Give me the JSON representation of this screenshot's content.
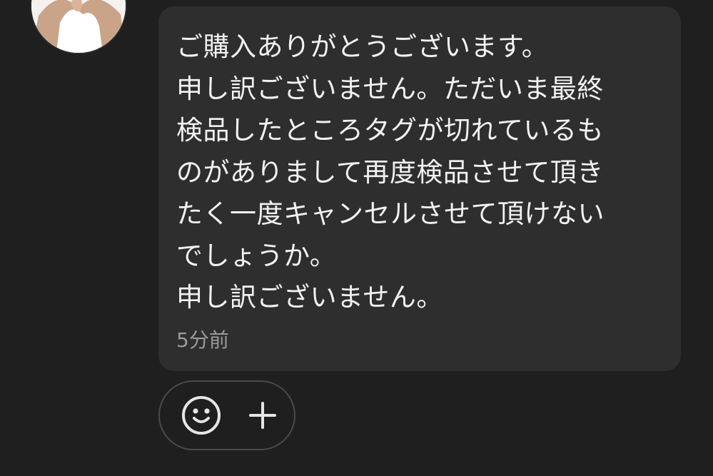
{
  "chat": {
    "message": {
      "lines": [
        "ご購入ありがとうございます。",
        "申し訳ございません。ただいま最終",
        "検品したところタグが切れているも",
        "のがありまして再度検品させて頂き",
        "たく一度キャンセルさせて頂けない",
        "でしょうか。",
        "申し訳ございません。"
      ],
      "timestamp": "5分前"
    },
    "reactions": {
      "emoji_icon": "smiley-icon",
      "add_icon": "plus-icon"
    },
    "avatar_icon": "avatar-photo"
  },
  "colors": {
    "background": "#1f1f1f",
    "bubble": "#2e2e2e",
    "text": "#f2f2f2",
    "timestamp": "#9a9a9a",
    "reaction_border": "#4a4a4a"
  }
}
